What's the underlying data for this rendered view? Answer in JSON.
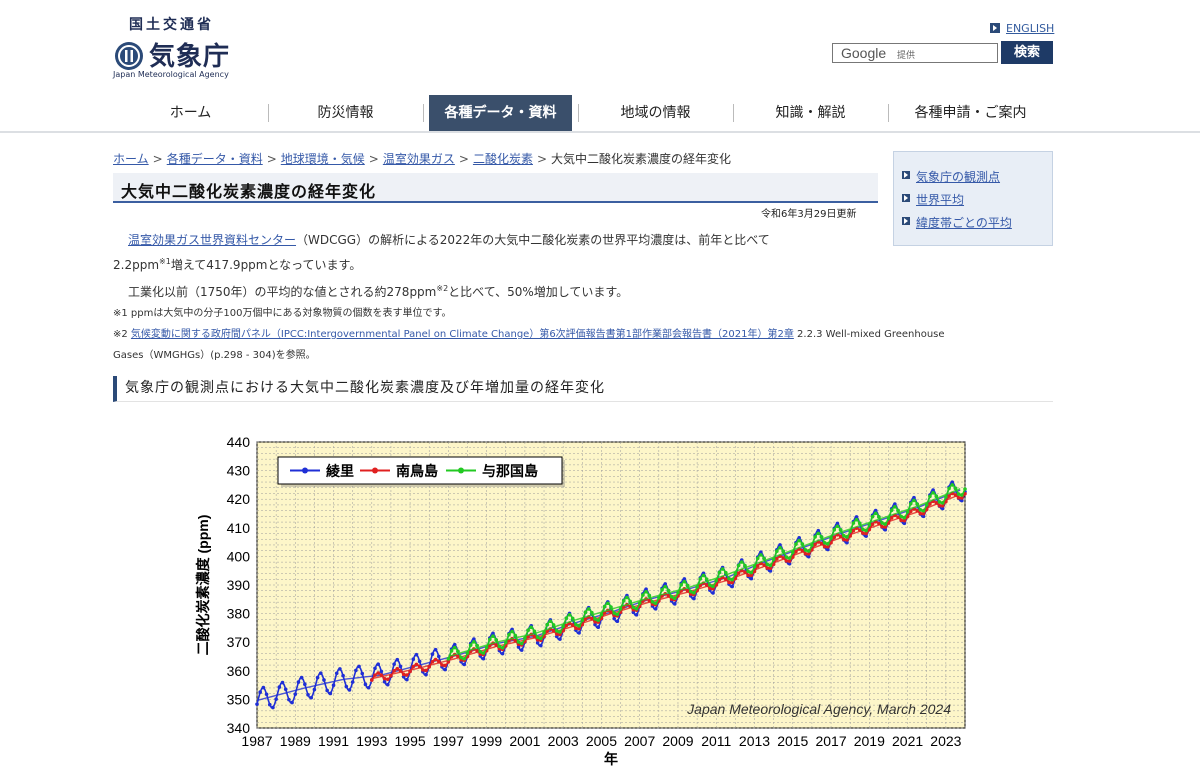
{
  "header": {
    "ministry": "国土交通省",
    "agency_name": "気象庁",
    "agency_name_en": "Japan Meteorological Agency",
    "english_link": "ENGLISH",
    "search_brand": "Google",
    "search_brand_suffix": "提供",
    "search_button": "検索"
  },
  "nav": {
    "items": [
      "ホーム",
      "防災情報",
      "各種データ・資料",
      "地域の情報",
      "知識・解説",
      "各種申請・ご案内"
    ],
    "active_index": 2
  },
  "breadcrumb": {
    "links": [
      "ホーム",
      "各種データ・資料",
      "地球環境・気候",
      "温室効果ガス",
      "二酸化炭素"
    ],
    "current": "大気中二酸化炭素濃度の経年変化"
  },
  "page": {
    "title": "大気中二酸化炭素濃度の経年変化",
    "updated": "令和6年3月29日更新",
    "para1_link": "温室効果ガス世界資料センター",
    "para1_text": "（WDCGG）の解析による2022年の大気中二酸化炭素の世界平均濃度は、前年と比べて",
    "para1_line2a": "2.2ppm",
    "para1_sup": "※1",
    "para1_line2b": "増えて417.9ppmとなっています。",
    "para2a": "工業化以前（1750年）の平均的な値とされる約278ppm",
    "para2_sup": "※2",
    "para2b": "と比べて、50%増加しています。",
    "note1": "※1 ppmは大気中の分子100万個中にある対象物質の個数を表す単位です。",
    "note2_prefix": "※2 ",
    "note2_link": "気候変動に関する政府間パネル（IPCC:Intergovernmental Panel on Climate Change）第6次評価報告書第1部作業部会報告書（2021年）第2章",
    "note2_text": " 2.2.3 Well-mixed Greenhouse",
    "note2_line2": "Gases（WMGHGs）(p.298 - 304)を参照。"
  },
  "side": {
    "links": [
      "気象庁の観測点",
      "世界平均",
      "緯度帯ごとの平均"
    ]
  },
  "section": {
    "heading": "気象庁の観測点における大気中二酸化炭素濃度及び年増加量の経年変化"
  },
  "colors": {
    "accent": "#2b4a78",
    "nav_active": "#3a4f6b",
    "plot_bg": "#fdf6c9",
    "ryori": "#1f2fd6",
    "minamitorishima": "#e02020",
    "yonagunijima": "#22c922"
  },
  "chart_data": {
    "type": "line",
    "title": "",
    "xlabel": "年",
    "ylabel": "二酸化炭素濃度 (ppm)",
    "xlim": [
      1987,
      2024
    ],
    "ylim": [
      340,
      440
    ],
    "yticks": [
      340,
      350,
      360,
      370,
      380,
      390,
      400,
      410,
      420,
      430,
      440
    ],
    "xticks": [
      1987,
      1989,
      1991,
      1993,
      1995,
      1997,
      1999,
      2001,
      2003,
      2005,
      2007,
      2009,
      2011,
      2013,
      2015,
      2017,
      2019,
      2021,
      2023
    ],
    "grid": true,
    "legend_position": "top-left",
    "annotation": "Japan Meteorological Agency, March 2024",
    "series": [
      {
        "name": "綾里",
        "color": "#1f2fd6",
        "x": [
          1987.5,
          1989.5,
          1991.5,
          1993.5,
          1995.5,
          1997.5,
          1999.5,
          2001.5,
          2003.5,
          2005.5,
          2007.5,
          2009.5,
          2011.5,
          2013.5,
          2015.5,
          2017.5,
          2019.5,
          2021.5,
          2023.5
        ],
        "values": [
          350.5,
          354.0,
          357.0,
          358.5,
          362.0,
          365.5,
          369.5,
          372.0,
          376.5,
          380.5,
          385.0,
          388.5,
          392.5,
          398.0,
          403.0,
          408.0,
          412.5,
          417.0,
          422.5
        ],
        "seasonal_amplitude": 8
      },
      {
        "name": "南鳥島",
        "color": "#e02020",
        "x": [
          1993.5,
          1995.5,
          1997.5,
          1999.5,
          2001.5,
          2003.5,
          2005.5,
          2007.5,
          2009.5,
          2011.5,
          2013.5,
          2015.5,
          2017.5,
          2019.5,
          2021.5,
          2023.5
        ],
        "values": [
          358.0,
          361.0,
          364.5,
          368.5,
          371.5,
          375.5,
          380.0,
          384.0,
          387.5,
          391.5,
          396.5,
          401.5,
          406.5,
          411.0,
          415.5,
          421.0
        ],
        "seasonal_amplitude": 3
      },
      {
        "name": "与那国島",
        "color": "#22c922",
        "x": [
          1997.5,
          1999.5,
          2001.5,
          2003.5,
          2005.5,
          2007.5,
          2009.5,
          2011.5,
          2013.5,
          2015.5,
          2017.5,
          2019.5,
          2021.5,
          2023.5
        ],
        "values": [
          366.0,
          370.0,
          373.0,
          377.5,
          381.5,
          385.5,
          389.0,
          393.5,
          398.5,
          403.5,
          408.5,
          413.0,
          417.5,
          423.0
        ],
        "seasonal_amplitude": 5
      }
    ]
  }
}
